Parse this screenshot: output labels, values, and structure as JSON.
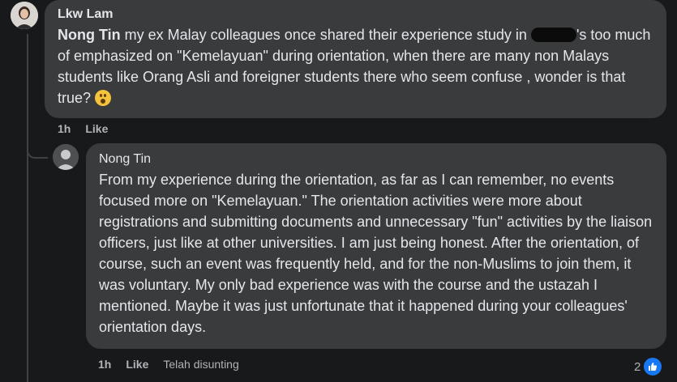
{
  "comment": {
    "author": "Lkw Lam",
    "mention": "Nong Tin",
    "text_before_redaction": " my ex Malay colleagues once shared their experience study in ",
    "text_after_redaction": "'s too much of emphasized on \"Kemelayuan\" during orientation, when there are many non Malays students like Orang Asli and foreigner students there who seem confuse , wonder is that true? ",
    "time": "1h",
    "like_label": "Like"
  },
  "reply": {
    "author": "Nong Tin",
    "text": "From my experience during the orientation, as far as I can remember, no events focused more on \"Kemelayuan.\" The orientation activities were more about registrations and submitting documents and unnecessary \"fun\" activities by the liaison officers, just like at other universities. I am just being honest. After the orientation, of course, such an event was frequently held, and for the non-Muslims to join them, it was voluntary. My only bad experience was with the course and the ustazah I mentioned. Maybe it was just unfortunate that it happened during your colleagues' orientation days.",
    "time": "1h",
    "like_label": "Like",
    "edited_label": "Telah disunting",
    "reaction_count": "2"
  },
  "icons": {
    "emoji": "astonished-face-emoji",
    "reaction": "thumbs-up-icon"
  },
  "colors": {
    "bubble": "#3a3b3c",
    "background": "#18191a",
    "like_blue": "#1877f2"
  }
}
